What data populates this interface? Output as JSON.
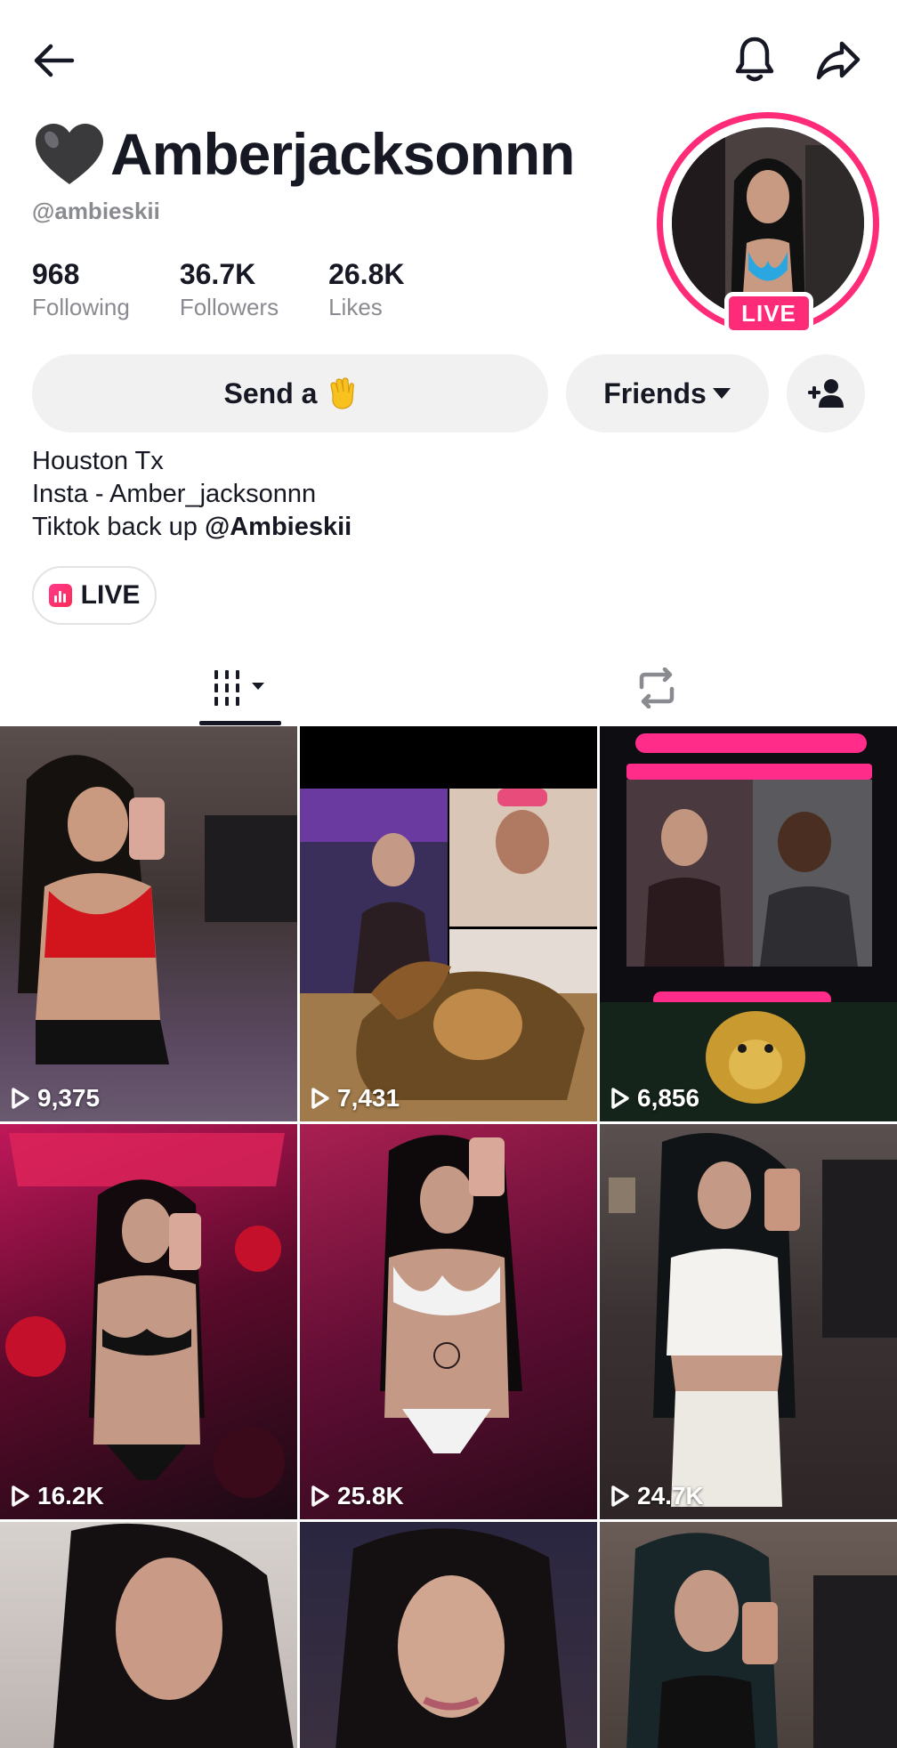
{
  "header": {
    "back_icon": "arrow-left-icon",
    "bell_icon": "bell-icon",
    "share_icon": "share-arrow-icon"
  },
  "profile": {
    "display_name": "Amberjacksonnn",
    "name_emoji": "black-heart-emoji",
    "username": "@ambieskii",
    "live_badge": "LIVE",
    "avatar_ring_color": "#fe2c78"
  },
  "stats": [
    {
      "value": "968",
      "label": "Following"
    },
    {
      "value": "36.7K",
      "label": "Followers"
    },
    {
      "value": "26.8K",
      "label": "Likes"
    }
  ],
  "actions": {
    "send_label": "Send a",
    "send_emoji": "waving-hand-emoji",
    "friends_label": "Friends",
    "add_friend_icon": "add-user-icon"
  },
  "bio": {
    "line1": "Houston Tx",
    "line2": "Insta - Amber_jacksonnn",
    "line3_prefix": "Tiktok back up ",
    "line3_mention": "@Ambieskii"
  },
  "live_pill": {
    "label": "LIVE"
  },
  "tabs": {
    "videos_icon": "video-grid-icon",
    "reposts_icon": "repost-icon"
  },
  "videos": [
    {
      "views": "9,375"
    },
    {
      "views": "7,431"
    },
    {
      "views": "6,856"
    },
    {
      "views": "16.2K"
    },
    {
      "views": "25.8K"
    },
    {
      "views": "24.7K"
    },
    {
      "views": ""
    },
    {
      "views": ""
    },
    {
      "views": ""
    }
  ],
  "colors": {
    "accent": "#fe2c78",
    "text": "#161823",
    "muted": "#8a8b91",
    "button_bg": "#f1f1f2"
  }
}
